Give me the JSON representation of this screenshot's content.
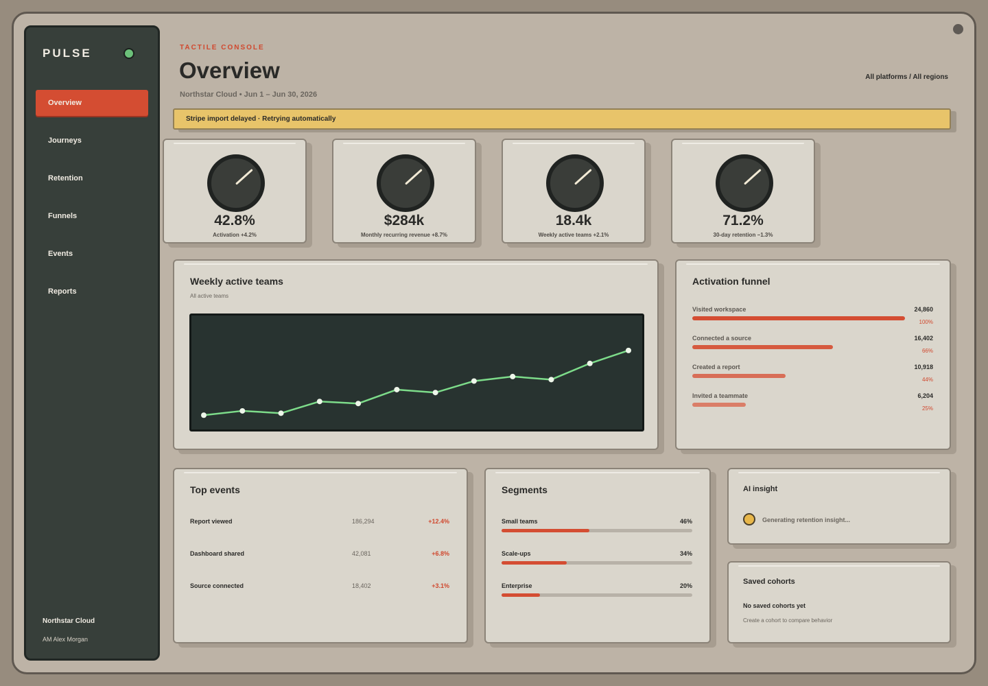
{
  "sidebar": {
    "brand": "PULSE",
    "items": [
      {
        "label": "Overview",
        "active": true
      },
      {
        "label": "Journeys"
      },
      {
        "label": "Retention"
      },
      {
        "label": "Funnels"
      },
      {
        "label": "Events"
      },
      {
        "label": "Reports"
      }
    ],
    "org": "Northstar Cloud",
    "user": "AM Alex Morgan"
  },
  "header": {
    "eyebrow": "TACTILE CONSOLE",
    "title": "Overview",
    "subtitle": "Northstar Cloud • Jun 1 – Jun 30, 2026",
    "filter": "All platforms / All regions"
  },
  "alert": "Stripe import delayed · Retrying automatically",
  "kpis": [
    {
      "value": "42.8%",
      "label": "Activation +4.2%"
    },
    {
      "value": "$284k",
      "label": "Monthly recurring revenue +8.7%"
    },
    {
      "value": "18.4k",
      "label": "Weekly active teams +2.1%"
    },
    {
      "value": "71.2%",
      "label": "30-day retention −1.3%"
    }
  ],
  "weekly": {
    "title": "Weekly active teams",
    "subtitle": "All active teams"
  },
  "chart_data": {
    "type": "line",
    "title": "Weekly active teams",
    "subtitle": "All active teams",
    "series": [
      {
        "values": [
          0.6,
          5.6,
          2.9,
          16.5,
          14.1,
          30.2,
          26.8,
          40.1,
          45.3,
          41.8,
          60.5,
          75.5
        ]
      }
    ],
    "ylim": [
      0,
      100
    ],
    "grid": false,
    "line_color": "#7ddc8a",
    "background": "#283330"
  },
  "funnel": {
    "title": "Activation funnel",
    "rows": [
      {
        "label": "Visited workspace",
        "value": "24,860",
        "pct": "100%",
        "fraction": 1.0,
        "color": "#d44d32"
      },
      {
        "label": "Connected a source",
        "value": "16,402",
        "pct": "66%",
        "fraction": 0.66,
        "color": "#d65a3f"
      },
      {
        "label": "Created a report",
        "value": "10,918",
        "pct": "44%",
        "fraction": 0.44,
        "color": "#d86e57"
      },
      {
        "label": "Invited a teammate",
        "value": "6,204",
        "pct": "25%",
        "fraction": 0.25,
        "color": "#da7e68"
      }
    ]
  },
  "top_events": {
    "title": "Top events",
    "rows": [
      {
        "name": "Report viewed",
        "count": "186,294",
        "delta": "+12.4%"
      },
      {
        "name": "Dashboard shared",
        "count": "42,081",
        "delta": "+6.8%"
      },
      {
        "name": "Source connected",
        "count": "18,402",
        "delta": "+3.1%"
      }
    ]
  },
  "segments": {
    "title": "Segments",
    "rows": [
      {
        "name": "Small teams",
        "pct": "46%",
        "fraction": 0.46
      },
      {
        "name": "Scale-ups",
        "pct": "34%",
        "fraction": 0.34
      },
      {
        "name": "Enterprise",
        "pct": "20%",
        "fraction": 0.2
      }
    ]
  },
  "ai_insight": {
    "title": "AI insight",
    "status": "Generating retention insight..."
  },
  "saved_cohorts": {
    "title": "Saved cohorts",
    "empty_title": "No saved cohorts yet",
    "empty_sub": "Create a cohort to compare behavior"
  }
}
